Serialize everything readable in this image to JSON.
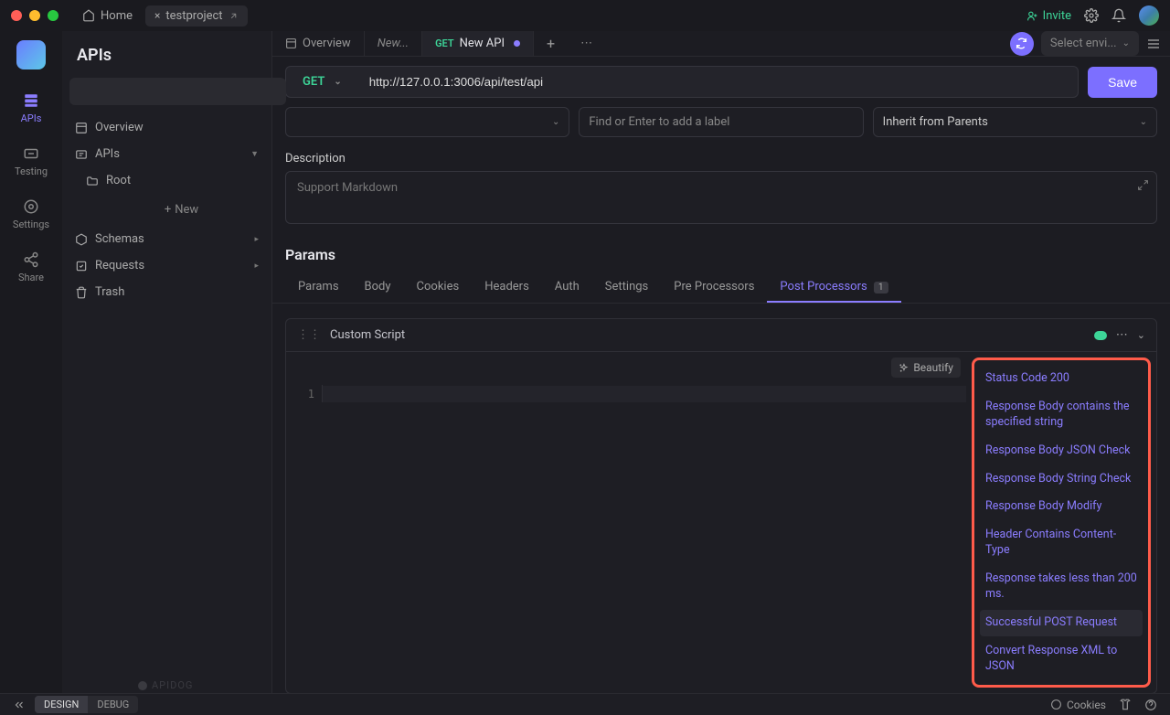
{
  "titlebar": {
    "home": "Home",
    "project_tab": "testproject",
    "invite": "Invite"
  },
  "rail": {
    "items": [
      {
        "label": "APIs"
      },
      {
        "label": "Testing"
      },
      {
        "label": "Settings"
      },
      {
        "label": "Share"
      }
    ]
  },
  "sidebar": {
    "title": "APIs",
    "search_placeholder": "",
    "items": {
      "overview": "Overview",
      "apis": "APIs",
      "root": "Root",
      "new": "New",
      "schemas": "Schemas",
      "requests": "Requests",
      "trash": "Trash"
    }
  },
  "tabs": {
    "overview": "Overview",
    "new": "New...",
    "api_method": "GET",
    "api_name": "New API",
    "add": "+",
    "env_placeholder": "Select envi..."
  },
  "request": {
    "method": "GET",
    "url": "http://127.0.0.1:3006/api/test/api",
    "save": "Save",
    "label_placeholder": "Find or Enter to add a label",
    "inherit": "Inherit from Parents",
    "description_label": "Description",
    "description_placeholder": "Support Markdown"
  },
  "params": {
    "header": "Params",
    "tabs": [
      {
        "label": "Params"
      },
      {
        "label": "Body"
      },
      {
        "label": "Cookies"
      },
      {
        "label": "Headers"
      },
      {
        "label": "Auth"
      },
      {
        "label": "Settings"
      },
      {
        "label": "Pre Processors"
      },
      {
        "label": "Post Processors",
        "badge": "1"
      }
    ]
  },
  "script": {
    "title": "Custom Script",
    "beautify": "Beautify",
    "line_number": "1",
    "snippets": [
      "Status Code 200",
      "Response Body contains the specified string",
      "Response Body JSON Check",
      "Response Body String Check",
      "Response Body Modify",
      "Header Contains Content-Type",
      "Response takes less than 200 ms.",
      "Successful POST Request",
      "Convert Response XML to JSON"
    ]
  },
  "statusbar": {
    "design": "DESIGN",
    "debug": "DEBUG",
    "cookies": "Cookies"
  },
  "footer_brand": "APIDOG"
}
